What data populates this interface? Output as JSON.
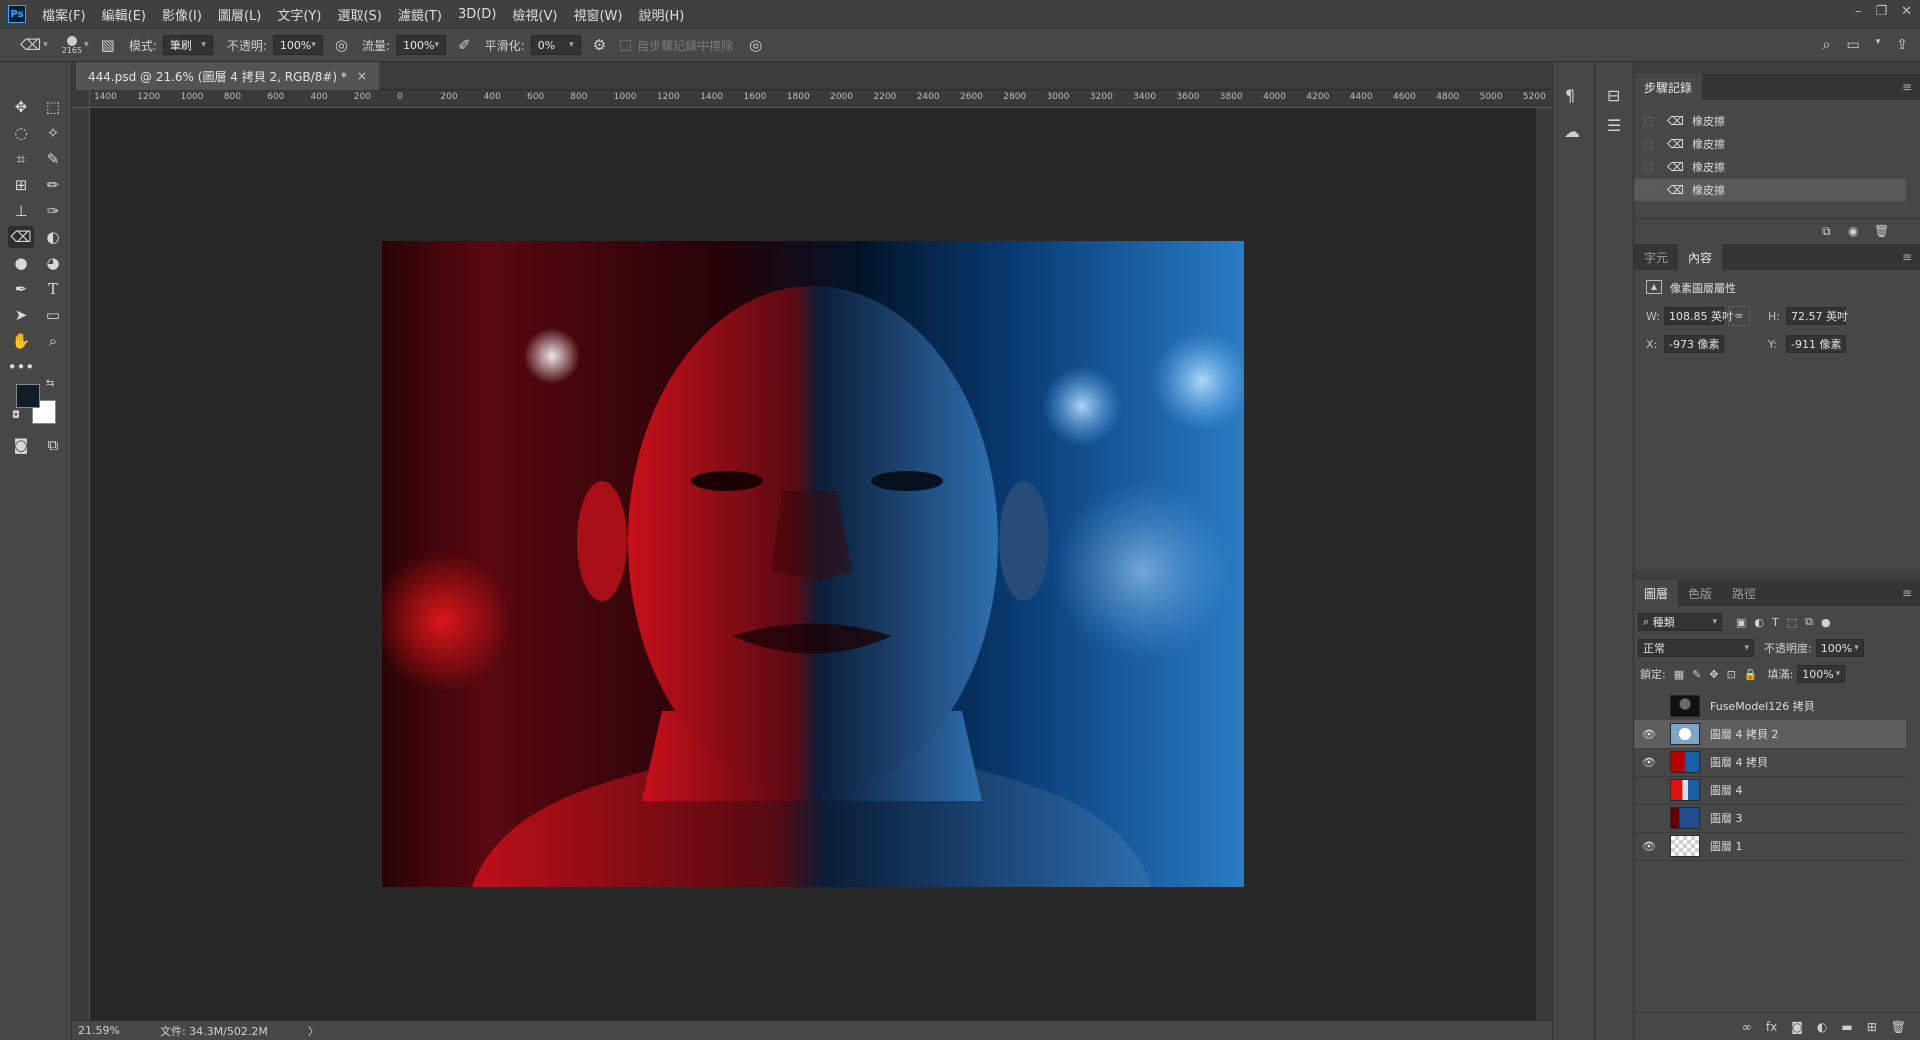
{
  "menubar": {
    "logo": "Ps",
    "items": [
      "檔案(F)",
      "編輯(E)",
      "影像(I)",
      "圖層(L)",
      "文字(Y)",
      "選取(S)",
      "濾鏡(T)",
      "3D(D)",
      "檢視(V)",
      "視窗(W)",
      "說明(H)"
    ],
    "window_controls": [
      "–",
      "❐",
      "✕"
    ]
  },
  "options": {
    "brush_size": "2165",
    "mode_label": "模式:",
    "mode_value": "筆刷",
    "opacity_label": "不透明:",
    "opacity_value": "100%",
    "flow_label": "流量:",
    "flow_value": "100%",
    "smoothing_label": "平滑化:",
    "smoothing_value": "0%",
    "erase_history_label": "自步驟記錄中擦除"
  },
  "document": {
    "tab_title": "444.psd @ 21.6% (圖層 4 拷貝 2, RGB/8#) *",
    "close": "×"
  },
  "ruler": {
    "h_labels": [
      "1400",
      "1200",
      "1000",
      "800",
      "600",
      "400",
      "200",
      "0",
      "200",
      "400",
      "600",
      "800",
      "1000",
      "1200",
      "1400",
      "1600",
      "1800",
      "2000",
      "2200",
      "2400",
      "2600",
      "2800",
      "3000",
      "3200",
      "3400",
      "3600",
      "3800",
      "4000",
      "4200",
      "4400",
      "4600",
      "4800",
      "5000",
      "5200"
    ]
  },
  "status": {
    "zoom": "21.59%",
    "doc_size": "文件: 34.3M/502.2M",
    "arrow": "〉"
  },
  "history_panel": {
    "tab": "步驟記錄",
    "items": [
      {
        "label": "橡皮擦"
      },
      {
        "label": "橡皮擦"
      },
      {
        "label": "橡皮擦"
      },
      {
        "label": "橡皮擦"
      }
    ]
  },
  "properties_panel": {
    "tabs": [
      "字元",
      "內容"
    ],
    "title": "像素圖層屬性",
    "w_label": "W:",
    "w_value": "108.85 英吋",
    "h_label": "H:",
    "h_value": "72.57 英吋",
    "x_label": "X:",
    "x_value": "-973 像素",
    "y_label": "Y:",
    "y_value": "-911 像素"
  },
  "layers_panel": {
    "tabs": [
      "圖層",
      "色版",
      "路徑"
    ],
    "filter_value": "種類",
    "blend_mode": "正常",
    "opacity_label": "不透明度:",
    "opacity_value": "100%",
    "lock_label": "鎖定:",
    "fill_label": "填滿:",
    "fill_value": "100%",
    "layers": [
      {
        "name": "FuseModel126 拷貝",
        "visible": false,
        "selected": false,
        "thumb": "portrait-dark"
      },
      {
        "name": "圖層 4 拷貝 2",
        "visible": true,
        "selected": true,
        "thumb": "light"
      },
      {
        "name": "圖層 4 拷貝",
        "visible": true,
        "selected": false,
        "thumb": "redblue"
      },
      {
        "name": "圖層 4",
        "visible": false,
        "selected": false,
        "thumb": "portrait"
      },
      {
        "name": "圖層 3",
        "visible": false,
        "selected": false,
        "thumb": "blue"
      },
      {
        "name": "圖層 1",
        "visible": true,
        "selected": false,
        "thumb": "transparent"
      }
    ]
  },
  "colors": {
    "foreground": "#0e1e26",
    "background": "#ffffff"
  }
}
